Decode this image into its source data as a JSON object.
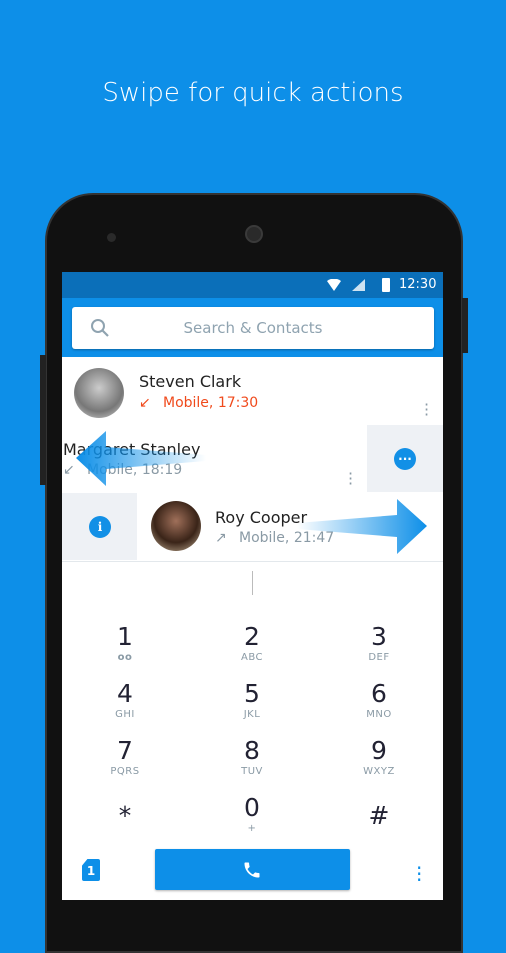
{
  "headline": "Swipe for quick actions",
  "status": {
    "time": "12:30"
  },
  "search": {
    "placeholder": "Search & Contacts"
  },
  "calls": [
    {
      "name": "Steven Clark",
      "detail": "Mobile, 17:30",
      "type": "missed",
      "color": "#f04a1c"
    },
    {
      "name": "Margaret Stanley",
      "detail": "Mobile, 18:19",
      "type": "incoming",
      "swipe_action": "message"
    },
    {
      "name": "Roy Cooper",
      "detail": "Mobile, 21:47",
      "type": "outgoing",
      "swipe_action": "info"
    }
  ],
  "keypad": [
    {
      "digit": "1",
      "letters": "voicemail-icon"
    },
    {
      "digit": "2",
      "letters": "ABC"
    },
    {
      "digit": "3",
      "letters": "DEF"
    },
    {
      "digit": "4",
      "letters": "GHI"
    },
    {
      "digit": "5",
      "letters": "JKL"
    },
    {
      "digit": "6",
      "letters": "MNO"
    },
    {
      "digit": "7",
      "letters": "PQRS"
    },
    {
      "digit": "8",
      "letters": "TUV"
    },
    {
      "digit": "9",
      "letters": "WXYZ"
    },
    {
      "digit": "*",
      "letters": ""
    },
    {
      "digit": "0",
      "letters": "+"
    },
    {
      "digit": "#",
      "letters": ""
    }
  ],
  "bottom": {
    "sim": "1"
  },
  "colors": {
    "accent": "#0d8fe8",
    "statusbar": "#0b6fb9",
    "missed": "#f04a1c"
  }
}
